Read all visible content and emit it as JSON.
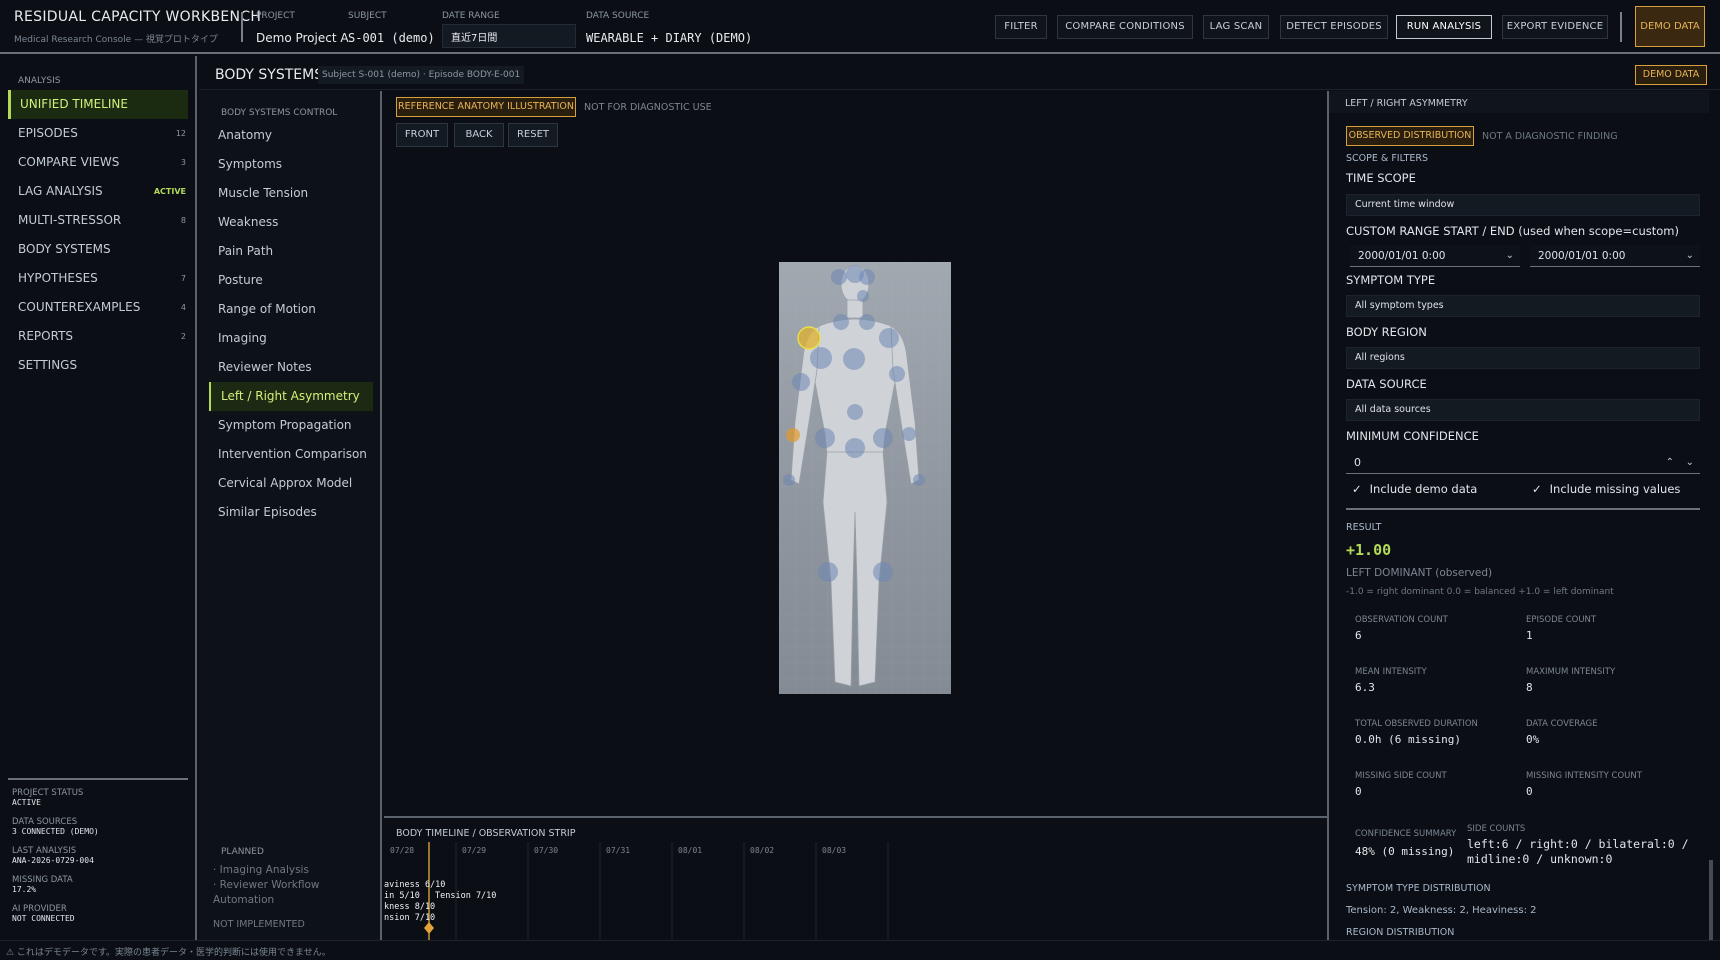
{
  "app": {
    "title": "RESIDUAL CAPACITY WORKBENCH",
    "subtitle": "Medical Research Console — 視覚プロトタイプ"
  },
  "topbar": {
    "project_label": "PROJECT",
    "project_value": "Demo Project A",
    "subject_label": "SUBJECT",
    "subject_value": "S-001 (demo)",
    "range_label": "DATE RANGE",
    "range_value": "直近7日間",
    "source_label": "DATA SOURCE",
    "source_value": "WEARABLE + DIARY (DEMO)",
    "buttons": [
      "FILTER",
      "COMPARE CONDITIONS",
      "LAG SCAN",
      "DETECT EPISODES",
      "RUN ANALYSIS",
      "EXPORT EVIDENCE"
    ],
    "demo_badge": "DEMO DATA"
  },
  "sidebar": {
    "heading": "ANALYSIS",
    "items": [
      {
        "label": "UNIFIED TIMELINE",
        "badge": ""
      },
      {
        "label": "EPISODES",
        "badge": "12"
      },
      {
        "label": "COMPARE VIEWS",
        "badge": "3"
      },
      {
        "label": "LAG ANALYSIS",
        "badge": "ACTIVE"
      },
      {
        "label": "MULTI-STRESSOR",
        "badge": "8"
      },
      {
        "label": "BODY SYSTEMS",
        "badge": ""
      },
      {
        "label": "HYPOTHESES",
        "badge": "7"
      },
      {
        "label": "COUNTEREXAMPLES",
        "badge": "4"
      },
      {
        "label": "REPORTS",
        "badge": "2"
      },
      {
        "label": "SETTINGS",
        "badge": ""
      }
    ],
    "status": [
      {
        "k": "PROJECT STATUS",
        "v": "ACTIVE"
      },
      {
        "k": "DATA SOURCES",
        "v": "3 CONNECTED (DEMO)"
      },
      {
        "k": "LAST ANALYSIS",
        "v": "ANA-2026-0729-004"
      },
      {
        "k": "MISSING DATA",
        "v": "17.2%"
      },
      {
        "k": "AI PROVIDER",
        "v": "NOT CONNECTED"
      }
    ]
  },
  "header": {
    "title": "BODY SYSTEMS",
    "crumb": "Subject S-001 (demo) · Episode BODY-E-001",
    "demo_badge": "DEMO DATA"
  },
  "control": {
    "heading": "BODY SYSTEMS CONTROL",
    "items": [
      "Anatomy",
      "Symptoms",
      "Muscle Tension",
      "Weakness",
      "Pain Path",
      "Posture",
      "Range of Motion",
      "Imaging",
      "Reviewer Notes",
      "Left / Right Asymmetry",
      "Symptom Propagation",
      "Intervention Comparison",
      "Cervical Approx Model",
      "Similar Episodes"
    ],
    "planned_heading": "PLANNED",
    "planned": [
      "· Imaging Analysis",
      "· Reviewer Workflow Automation"
    ],
    "not_implemented": "NOT IMPLEMENTED"
  },
  "center": {
    "ref_badge": "REFERENCE ANATOMY ILLUSTRATION",
    "ref_note": "NOT FOR DIAGNOSTIC USE",
    "view_buttons": [
      "FRONT",
      "BACK",
      "RESET"
    ]
  },
  "strip": {
    "title": "BODY TIMELINE / OBSERVATION STRIP",
    "dates": [
      "07/28",
      "07/29",
      "07/30",
      "07/31",
      "08/01",
      "08/02",
      "08/03"
    ],
    "events": [
      "aviness 6/10",
      "in 5/10",
      "kness 8/10",
      "nsion 7/10",
      "Tension 7/10"
    ]
  },
  "right": {
    "heading": "LEFT / RIGHT ASYMMETRY",
    "obs_badge": "OBSERVED DISTRIBUTION",
    "obs_note": "NOT A DIAGNOSTIC FINDING",
    "scope_heading": "SCOPE & FILTERS",
    "time_scope_label": "TIME SCOPE",
    "time_scope_value": "Current time window",
    "custom_range_label": "CUSTOM RANGE START / END (used when scope=custom)",
    "range_start": "2000/01/01 0:00",
    "range_end": "2000/01/01 0:00",
    "symptom_type_label": "SYMPTOM TYPE",
    "symptom_type_value": "All symptom types",
    "body_region_label": "BODY REGION",
    "body_region_value": "All regions",
    "data_source_label": "DATA SOURCE",
    "data_source_value": "All data sources",
    "min_conf_label": "MINIMUM CONFIDENCE",
    "min_conf_value": "0",
    "include_demo": "Include demo data",
    "include_missing": "Include missing values",
    "result_label": "RESULT",
    "result_value": "+1.00",
    "result_sub": "LEFT DOMINANT (observed)",
    "result_scale": "-1.0 = right dominant   0.0 = balanced   +1.0 = left dominant",
    "metrics": [
      {
        "k": "OBSERVATION COUNT",
        "v": "6"
      },
      {
        "k": "EPISODE COUNT",
        "v": "1"
      },
      {
        "k": "MEAN INTENSITY",
        "v": "6.3"
      },
      {
        "k": "MAXIMUM INTENSITY",
        "v": "8"
      },
      {
        "k": "TOTAL OBSERVED DURATION",
        "v": "0.0h (6 missing)"
      },
      {
        "k": "DATA COVERAGE",
        "v": "0%"
      },
      {
        "k": "MISSING SIDE COUNT",
        "v": "0"
      },
      {
        "k": "MISSING INTENSITY COUNT",
        "v": "0"
      }
    ],
    "conf_label": "CONFIDENCE SUMMARY",
    "conf_value": "48% (0 missing)",
    "side_label": "SIDE COUNTS",
    "side_value": "left:6 / right:0 / bilateral:0 / midline:0 / unknown:0",
    "sym_dist_label": "SYMPTOM TYPE DISTRIBUTION",
    "sym_dist_value": "Tension: 2, Weakness: 2, Heaviness: 2",
    "region_label": "REGION DISTRIBUTION"
  },
  "footer": "⚠ これはデモデータです。実際の患者データ・医学的判断には使用できません。",
  "colors": {
    "accent": "#b4d957",
    "warning": "#d6a03c",
    "bg": "#0b0f15"
  }
}
